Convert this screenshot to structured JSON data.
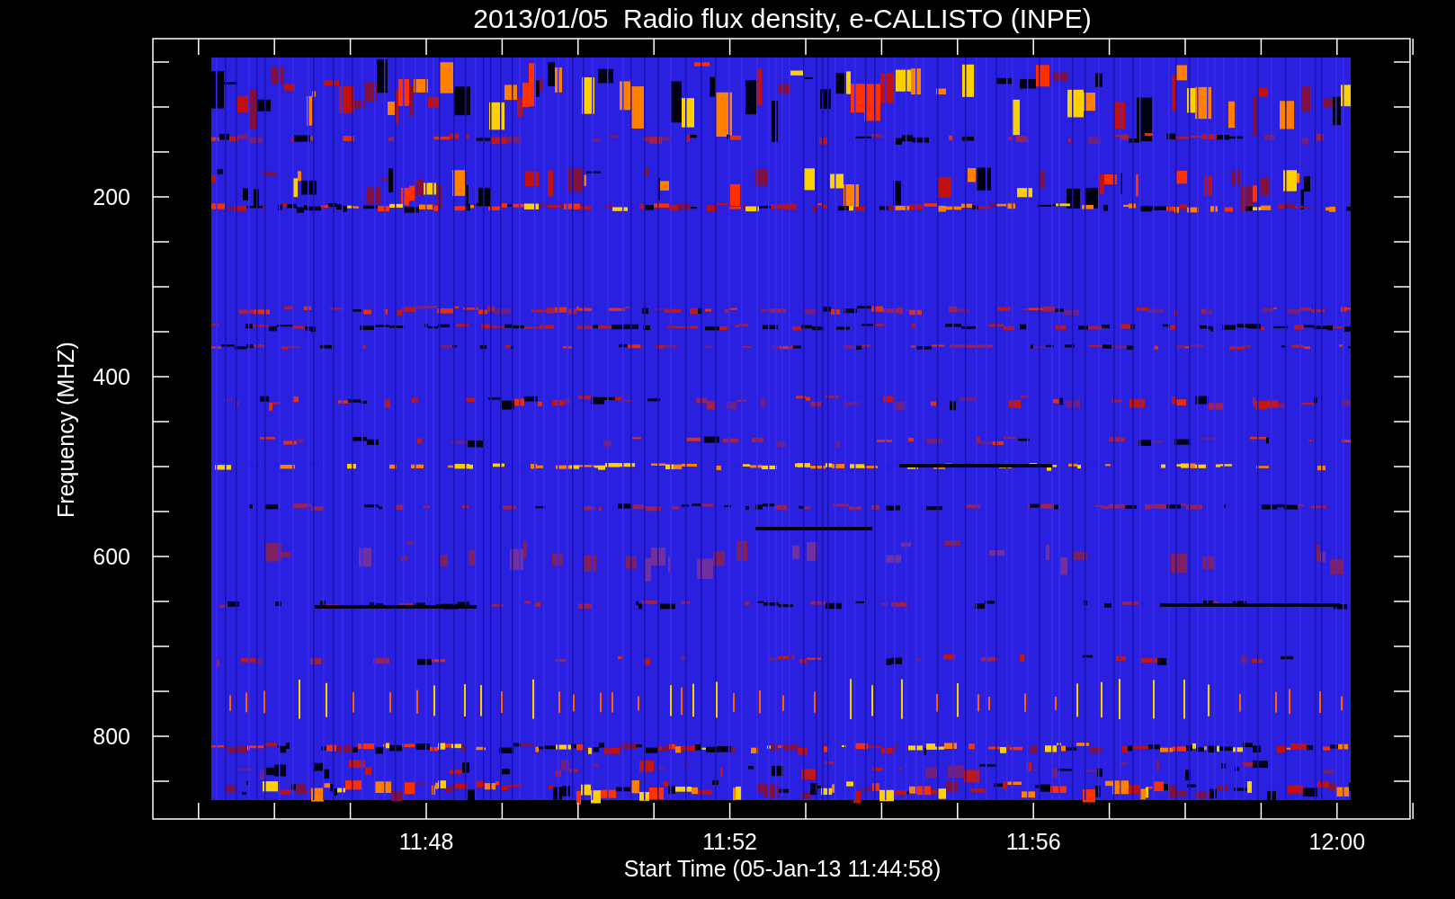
{
  "title": "2013/01/05  Radio flux density, e-CALLISTO (INPE)",
  "y_axis": {
    "label": "Frequency (MHZ)",
    "ticks": [
      "200",
      "400",
      "600",
      "800"
    ]
  },
  "x_axis": {
    "label": "Start Time (05-Jan-13 11:44:58)",
    "ticks": [
      "11:48",
      "11:52",
      "11:56",
      "12:00"
    ]
  }
}
